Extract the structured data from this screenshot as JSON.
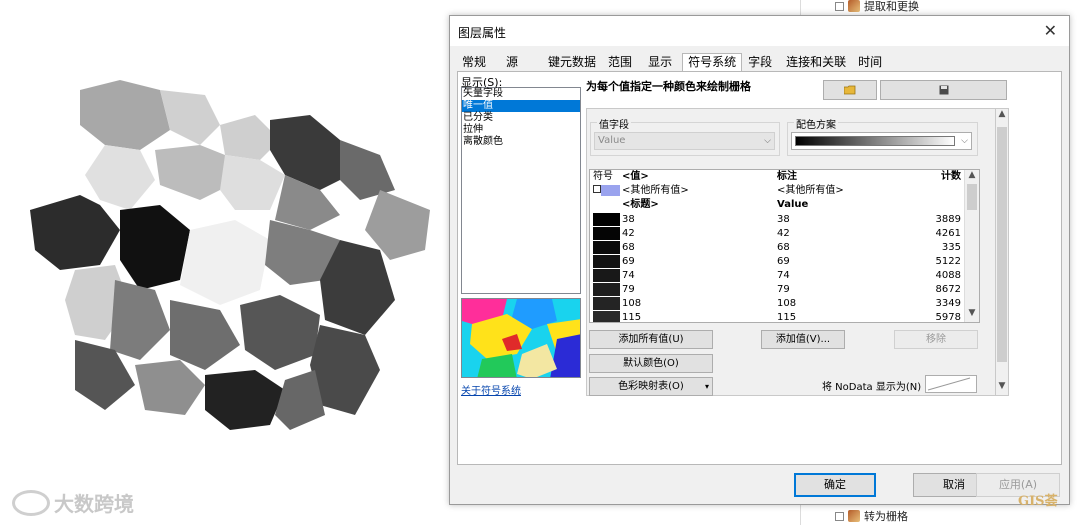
{
  "watermark": {
    "text": "大数跨境"
  },
  "corner_badge": {
    "text": "GIS荟"
  },
  "catalog": {
    "item_top": "提取和更换",
    "item_bottom": "转为栅格"
  },
  "dialog": {
    "title": "图层属性",
    "close_glyph": "✕",
    "tabs": [
      "常规",
      "源",
      "键元数据",
      "范围",
      "显示",
      "符号系统",
      "字段",
      "连接和关联",
      "时间"
    ],
    "active_tab": "符号系统",
    "show_label": "显示(S):",
    "show_items": [
      "矢量字段",
      "唯一值",
      "已分类",
      "拉伸",
      "离散颜色"
    ],
    "selected_show_item": "唯一值",
    "about_link": "关于符号系统",
    "headline": "为每个值指定一种颜色来绘制栅格",
    "value_field_group": "值字段",
    "value_field_value": "Value",
    "color_scheme_group": "配色方案",
    "table_headers": {
      "symbol": "符号",
      "value": "<值>",
      "label": "标注",
      "count": "计数"
    },
    "other_row": {
      "value": "<其他所有值>",
      "label": "<其他所有值>"
    },
    "heading_row": {
      "value": "<标题>",
      "label": "Value"
    },
    "rows": [
      {
        "value": "38",
        "label": "38",
        "count": "3889"
      },
      {
        "value": "42",
        "label": "42",
        "count": "4261"
      },
      {
        "value": "68",
        "label": "68",
        "count": "335"
      },
      {
        "value": "69",
        "label": "69",
        "count": "5122"
      },
      {
        "value": "74",
        "label": "74",
        "count": "4088"
      },
      {
        "value": "79",
        "label": "79",
        "count": "8672"
      },
      {
        "value": "108",
        "label": "108",
        "count": "3349"
      },
      {
        "value": "115",
        "label": "115",
        "count": "5978"
      }
    ],
    "buttons": {
      "add_all": "添加所有值(U)",
      "add_values": "添加值(V)...",
      "remove": "移除",
      "default_colors": "默认颜色(O)",
      "color_map": "色彩映射表(O)"
    },
    "nodata_label": "将 NoData 显示为(N)",
    "footer": {
      "ok": "确定",
      "cancel": "取消",
      "apply": "应用(A)"
    }
  }
}
